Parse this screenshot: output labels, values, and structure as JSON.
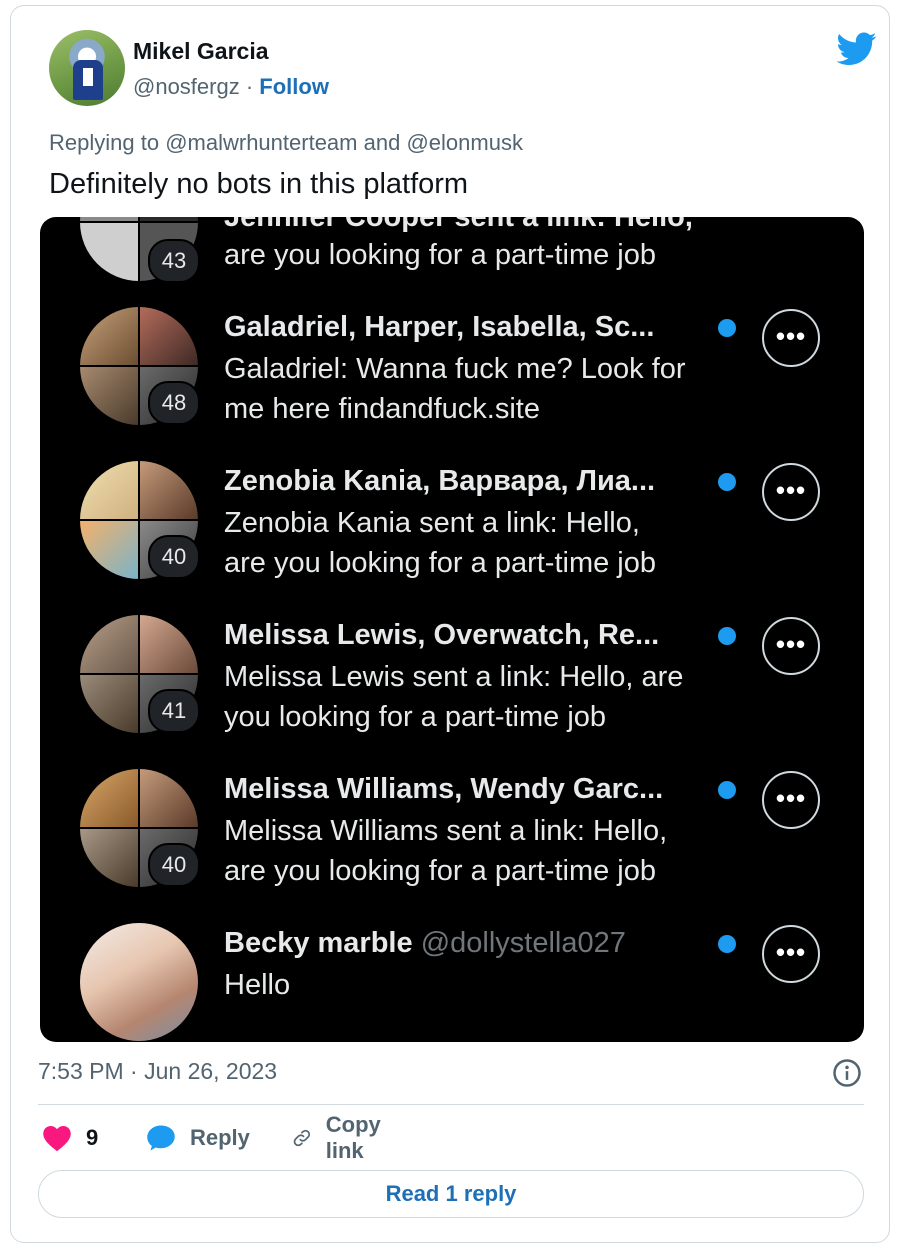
{
  "author": {
    "name": "Mikel Garcia",
    "handle": "@nosfergz",
    "separator": "·",
    "follow_label": "Follow"
  },
  "reply_context": {
    "prefix": "Replying to",
    "mention1": "@malwrhunterteam",
    "conjunction": "and",
    "mention2": "@elonmusk"
  },
  "tweet_text": "Definitely no bots in this platform",
  "dm_list": [
    {
      "title": "Jennifer Cooper sent a link: Hello,",
      "lines": [
        "are you looking for a part-time job"
      ],
      "count": "43"
    },
    {
      "title": "Galadriel, Harper, Isabella, Sc...",
      "lines": [
        "Galadriel: Wanna fuck me? Look for",
        "me here findandfuck.site"
      ],
      "count": "48"
    },
    {
      "title": "Zenobia Kania, Варвара, Лиа...",
      "lines": [
        "Zenobia Kania sent a link: Hello,",
        "are you looking for a part-time job"
      ],
      "count": "40"
    },
    {
      "title": "Melissa Lewis, Overwatch, Re...",
      "lines": [
        "Melissa Lewis sent a link: Hello, are",
        "you looking for a part-time job"
      ],
      "count": "41"
    },
    {
      "title": "Melissa Williams, Wendy Garc...",
      "lines": [
        "Melissa Williams sent a link: Hello,",
        "are you looking for a part-time job"
      ],
      "count": "40"
    },
    {
      "title": "Becky marble",
      "handle": "@dollystella027",
      "lines": [
        "Hello"
      ]
    }
  ],
  "more_label": "•••",
  "timestamp": "7:53 PM · Jun 26, 2023",
  "actions": {
    "like_count": "9",
    "reply_label": "Reply",
    "copy_label": "Copy link"
  },
  "read_reply_label": "Read 1 reply",
  "colors": {
    "link_blue": "#1d6fb8",
    "like_pink": "#f91880",
    "twitter_blue": "#1d9bf0",
    "unread_dot": "#1d9bf0"
  }
}
